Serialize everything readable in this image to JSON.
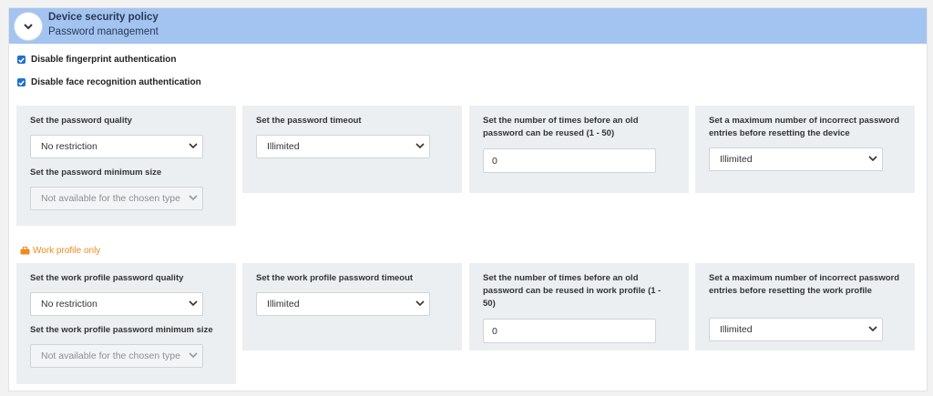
{
  "header": {
    "title": "Device security policy",
    "subtitle": "Password management"
  },
  "checkboxes": [
    {
      "label": "Disable fingerprint authentication",
      "checked": true
    },
    {
      "label": "Disable face recognition authentication",
      "checked": true
    }
  ],
  "device_section": {
    "quality_label": "Set the password quality",
    "quality_value": "No restriction",
    "min_size_label": "Set the password minimum size",
    "min_size_value": "Not available for the chosen type",
    "timeout_label": "Set the password timeout",
    "timeout_value": "Illimited",
    "reuse_label": "Set the number of times before an old password can be reused (1 - 50)",
    "reuse_value": "0",
    "max_incorrect_label": "Set a maximum number of incorrect password entries before resetting the device",
    "max_incorrect_value": "Illimited"
  },
  "work_profile_label": "Work profile only",
  "work_section": {
    "quality_label": "Set the work profile password quality",
    "quality_value": "No restriction",
    "min_size_label": "Set the work profile password minimum size",
    "min_size_value": "Not available for the chosen type",
    "timeout_label": "Set the work profile password timeout",
    "timeout_value": "Illimited",
    "reuse_label": "Set the number of times before an old password can be reused in work profile (1 - 50)",
    "reuse_value": "0",
    "max_incorrect_label": "Set a maximum number of incorrect password entries before resetting the work profile",
    "max_incorrect_value": "Illimited"
  },
  "colors": {
    "header_bg": "#a3c4f0",
    "card_bg": "#eceff1",
    "checkbox": "#1f6fd1",
    "work_profile": "#f08a1d"
  },
  "icons": {
    "toggle": "chevron-down-icon",
    "checkbox": "checkmark-icon",
    "work_profile": "briefcase-icon",
    "select": "chevron-down-icon"
  }
}
